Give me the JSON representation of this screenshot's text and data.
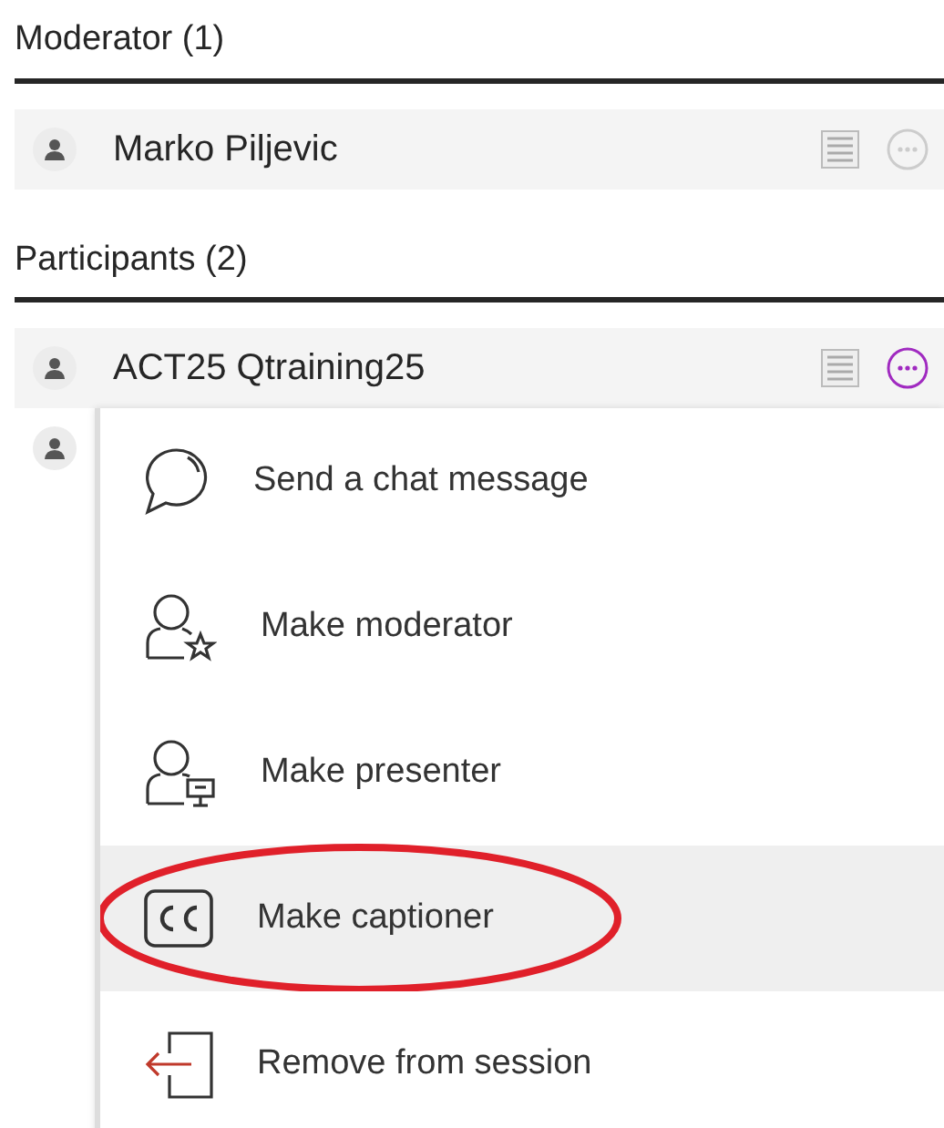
{
  "sections": [
    {
      "title": "Moderator (1)",
      "attendees": [
        {
          "name": "Marko Piljevic",
          "menu_open": false
        }
      ]
    },
    {
      "title": "Participants (2)",
      "attendees": [
        {
          "name": "ACT25 Qtraining25",
          "menu_open": true
        },
        {
          "kind": "covered"
        }
      ]
    }
  ],
  "context_menu": {
    "items": [
      {
        "kind": "chat",
        "label": "Send a chat message",
        "selected": false,
        "circled": false
      },
      {
        "kind": "moderator",
        "label": "Make moderator",
        "selected": false,
        "circled": false
      },
      {
        "kind": "presenter",
        "label": "Make presenter",
        "selected": false,
        "circled": false
      },
      {
        "kind": "captioner",
        "label": "Make captioner",
        "selected": true,
        "circled": true
      },
      {
        "kind": "remove",
        "label": "Remove from session",
        "selected": false,
        "circled": false
      }
    ]
  }
}
